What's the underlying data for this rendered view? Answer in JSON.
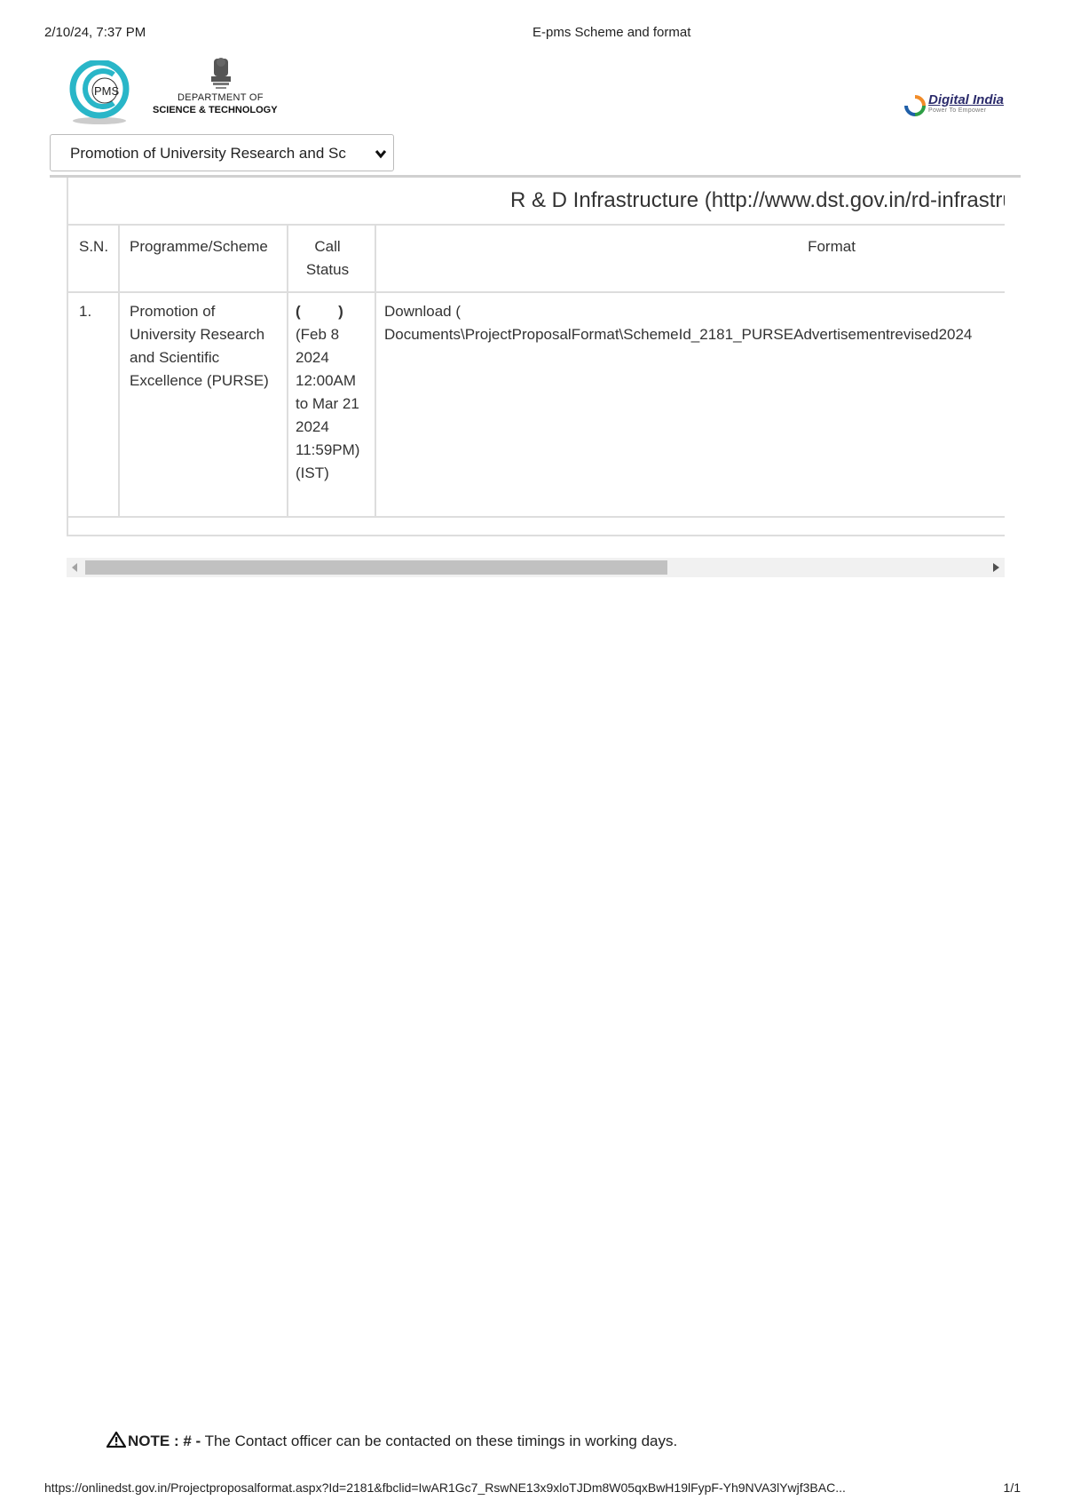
{
  "print_header": {
    "datetime": "2/10/24, 7:37 PM",
    "document_title": "E-pms Scheme and format"
  },
  "branding": {
    "pms_logo_text": "PMS",
    "department_line1": "DEPARTMENT OF",
    "department_line2": "SCIENCE & TECHNOLOGY",
    "digital_india_text": "Digital India",
    "digital_india_tagline": "Power To Empower"
  },
  "scheme_select": {
    "selected_value": "Promotion of University Research and Sc"
  },
  "table": {
    "title": "R & D Infrastructure (http://www.dst.gov.in/rd-infrastruc",
    "headers": {
      "sn": "S.N.",
      "programme": "Programme/Scheme",
      "call_line1": "Call",
      "call_line2": "Status",
      "format": "Format"
    },
    "rows": [
      {
        "sn": "1.",
        "programme": "Promotion of University Research and Scientific Excellence (PURSE)",
        "call_status_paren": "(         )",
        "call_status": "(Feb 8 2024 12:00AM to Mar 21 2024 11:59PM) (IST)",
        "format_prefix": "Download (",
        "format_path": "Documents\\ProjectProposalFormat\\SchemeId_2181_PURSEAdvertisementrevised2024"
      }
    ]
  },
  "note": {
    "label": "NOTE : # -",
    "text": " The Contact officer can be contacted on these timings in working days."
  },
  "print_footer": {
    "url": "https://onlinedst.gov.in/Projectproposalformat.aspx?Id=2181&fbclid=IwAR1Gc7_RswNE13x9xloTJDm8W05qxBwH19lFypF-Yh9NVA3lYwjf3BAC...",
    "page": "1/1"
  },
  "colors": {
    "border": "#dddddd",
    "scroll_thumb": "#c1c1c1",
    "scroll_track": "#f1f1f1",
    "pms_ring": "#29b6c8"
  }
}
